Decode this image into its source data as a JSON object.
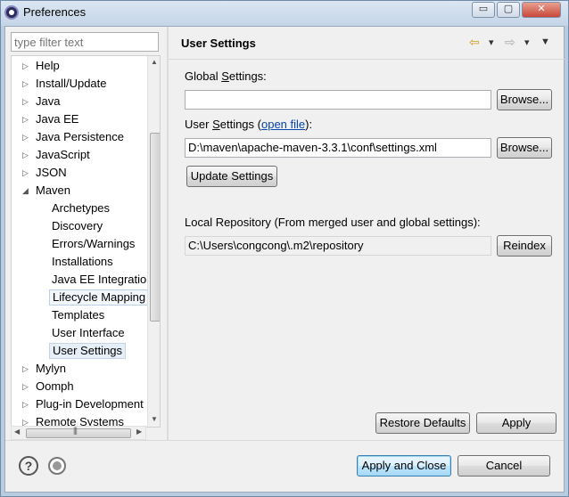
{
  "window": {
    "title": "Preferences",
    "minimize_label": "▭",
    "maximize_label": "▢",
    "close_label": "✕"
  },
  "filter": {
    "placeholder": "type filter text"
  },
  "tree": {
    "items": [
      {
        "label": "Help",
        "twisty": "▷"
      },
      {
        "label": "Install/Update",
        "twisty": "▷"
      },
      {
        "label": "Java",
        "twisty": "▷"
      },
      {
        "label": "Java EE",
        "twisty": "▷"
      },
      {
        "label": "Java Persistence",
        "twisty": "▷"
      },
      {
        "label": "JavaScript",
        "twisty": "▷"
      },
      {
        "label": "JSON",
        "twisty": "▷"
      },
      {
        "label": "Maven",
        "twisty": "◢"
      },
      {
        "label": "Archetypes"
      },
      {
        "label": "Discovery"
      },
      {
        "label": "Errors/Warnings"
      },
      {
        "label": "Installations"
      },
      {
        "label": "Java EE Integration"
      },
      {
        "label": "Lifecycle Mapping"
      },
      {
        "label": "Templates"
      },
      {
        "label": "User Interface"
      },
      {
        "label": "User Settings"
      },
      {
        "label": "Mylyn",
        "twisty": "▷"
      },
      {
        "label": "Oomph",
        "twisty": "▷"
      },
      {
        "label": "Plug-in Development",
        "twisty": "▷"
      },
      {
        "label": "Remote Systems",
        "twisty": "▷"
      }
    ],
    "scroll_up": "▲",
    "scroll_down": "▼",
    "scroll_left": "◀",
    "scroll_right": "▶",
    "hgrip": "|||"
  },
  "page": {
    "title": "User Settings",
    "nav_back": "⇦",
    "nav_back_menu": "▾",
    "nav_forward": "⇨",
    "nav_forward_menu": "▾",
    "view_menu": "▼",
    "global_settings_label_pre": "Global ",
    "global_settings_label_mnemonic": "S",
    "global_settings_label_post": "ettings:",
    "global_settings_value": "",
    "browse_label": "Browse...",
    "user_settings_label_pre": "User ",
    "user_settings_label_mnemonic": "S",
    "user_settings_label_mid": "ettings (",
    "user_settings_link": "open file",
    "user_settings_label_post": "):",
    "user_settings_value": "D:\\maven\\apache-maven-3.3.1\\conf\\settings.xml",
    "update_settings_label": "Update Settings",
    "local_repo_label": "Local Repository (From merged user and global settings):",
    "local_repo_value": "C:\\Users\\congcong\\.m2\\repository",
    "reindex_label": "Reindex",
    "restore_defaults_label": "Restore Defaults",
    "apply_label": "Apply"
  },
  "footer": {
    "help_glyph": "?",
    "apply_close_label": "Apply and Close",
    "cancel_label": "Cancel"
  },
  "colors": {
    "link": "#0645ad",
    "default_button_border": "#3c7fb1",
    "selection_bg": "#e6eef7"
  }
}
